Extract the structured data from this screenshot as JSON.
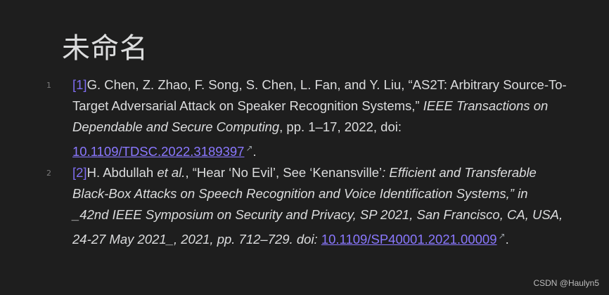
{
  "document": {
    "title": "未命名"
  },
  "references": [
    {
      "line": "1",
      "label": "[1]",
      "authors": "G. Chen, Z. Zhao, F. Song, S. Chen, L. Fan, and Y. Liu, “AS2T: Arbitrary Source-To-Target Adversarial Attack on Speaker Recognition Systems,” ",
      "venue_italic": "IEEE Transactions on Dependable and Secure Computing",
      "details": ", pp. 1–17, 2022, doi: ",
      "doi": "10.1109/TDSC.2022.3189397",
      "end": "."
    },
    {
      "line": "2",
      "label": "[2]",
      "authors_a": "H. Abdullah ",
      "etal_italic": "et al.",
      "authors_b": ", “Hear ‘No Evil’, See ‘Kenansville’",
      "title_italic": ": Efficient and Transferable Black-Box Attacks on Speech Recognition and Voice Identification Systems,” in _42nd IEEE Symposium on Security and Privacy, SP 2021, San Francisco, CA, USA, 24-27 May 2021_, 2021, pp. 712–729. doi: ",
      "doi": "10.1109/SP40001.2021.00009",
      "end": "."
    }
  ],
  "icons": {
    "external_link": "external-link-icon"
  },
  "watermark": "CSDN @Haulyn5"
}
